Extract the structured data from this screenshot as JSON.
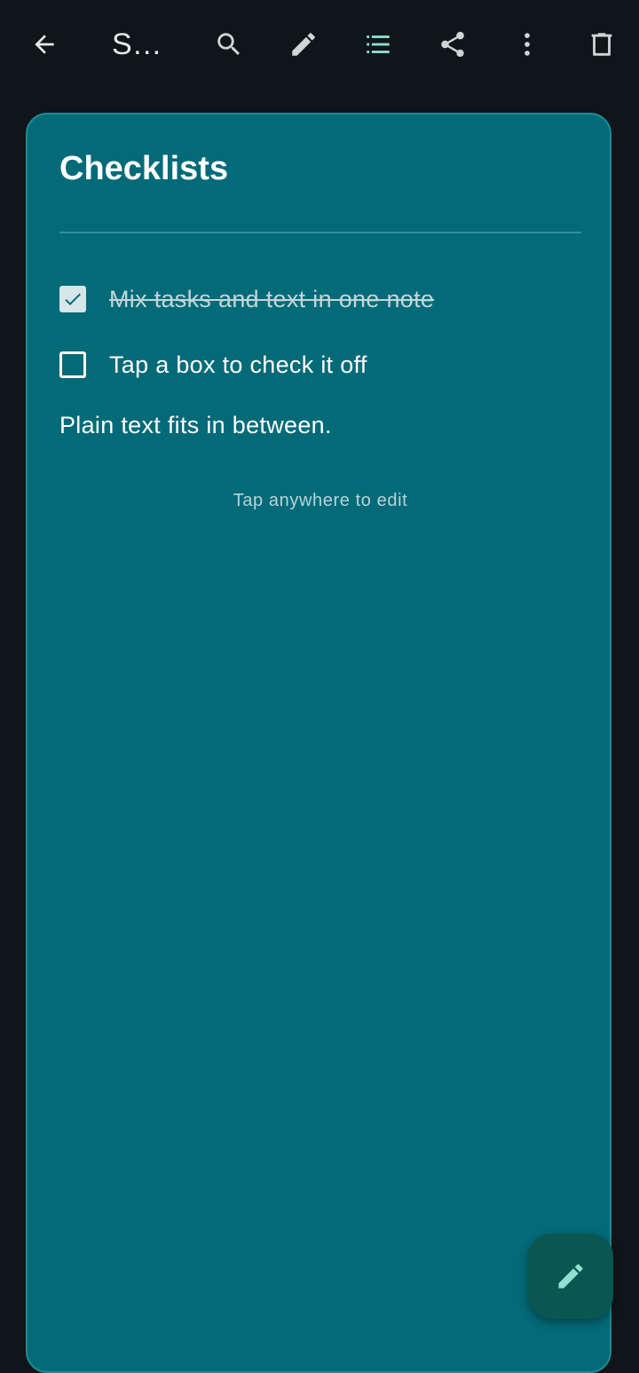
{
  "toolbar": {
    "title": "S…",
    "icons": [
      "back-arrow-icon",
      "search-icon",
      "pencil-icon",
      "checklist-icon",
      "share-icon",
      "more-vert-icon",
      "trash-icon"
    ]
  },
  "note": {
    "title": "Checklists",
    "items": [
      {
        "label": "Mix tasks and text in one note",
        "checked": true
      },
      {
        "label": "Tap a box to check it off",
        "checked": false
      }
    ],
    "plain_text": "Plain text fits in between.",
    "hint": "Tap anywhere to edit"
  },
  "fab": {
    "icon": "pencil-icon"
  },
  "colors": {
    "background": "#0f1518",
    "card": "#036a78",
    "accent": "#8fe0d0",
    "fab": "#0a5751"
  }
}
